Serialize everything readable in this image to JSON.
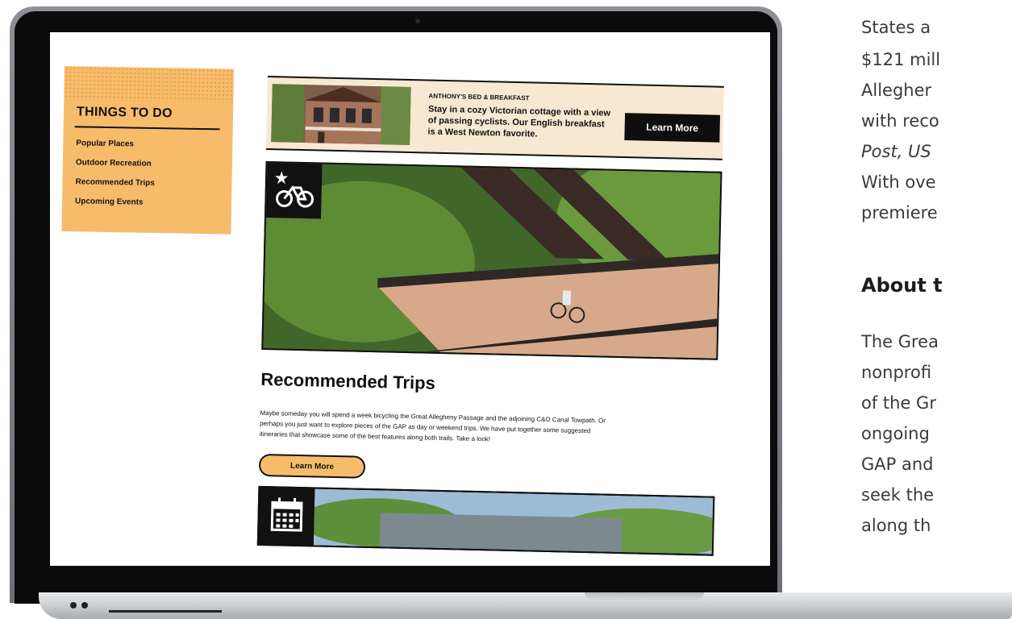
{
  "article": {
    "lines": [
      "States a",
      "$121 mill",
      "Allegher",
      "with reco",
      "With ove",
      "premiere"
    ],
    "italic_line": "Post, US",
    "heading": "About t",
    "lines2": [
      "The Grea",
      "nonprofi",
      "of the Gr",
      "ongoing",
      "GAP and",
      "seek the",
      "along th"
    ]
  },
  "sidebar": {
    "title": "THINGS TO DO",
    "items": [
      "Popular Places",
      "Outdoor Recreation",
      "Recommended Trips",
      "Upcoming Events"
    ]
  },
  "ad": {
    "title": "ANTHONY'S BED & BREAKFAST",
    "description": "Stay in a cozy Victorian cottage with a view of passing cyclists. Our English breakfast is a West Newton favorite.",
    "button_label": "Learn More"
  },
  "feature": {
    "heading": "Recommended Trips",
    "body": "Maybe someday you will spend a week bicycling the Great Allegheny Passage and the adjoining C&O Canal Towpath. Or perhaps you just want to explore pieces of the GAP as day or weekend trips. We have put together some suggested itineraries that showcase some of the best features along both trails.  Take a look!",
    "button_label": "Learn More"
  },
  "colors": {
    "accent": "#f7bc6b",
    "ink": "#111111",
    "ad_bg": "#f7e8d2"
  }
}
